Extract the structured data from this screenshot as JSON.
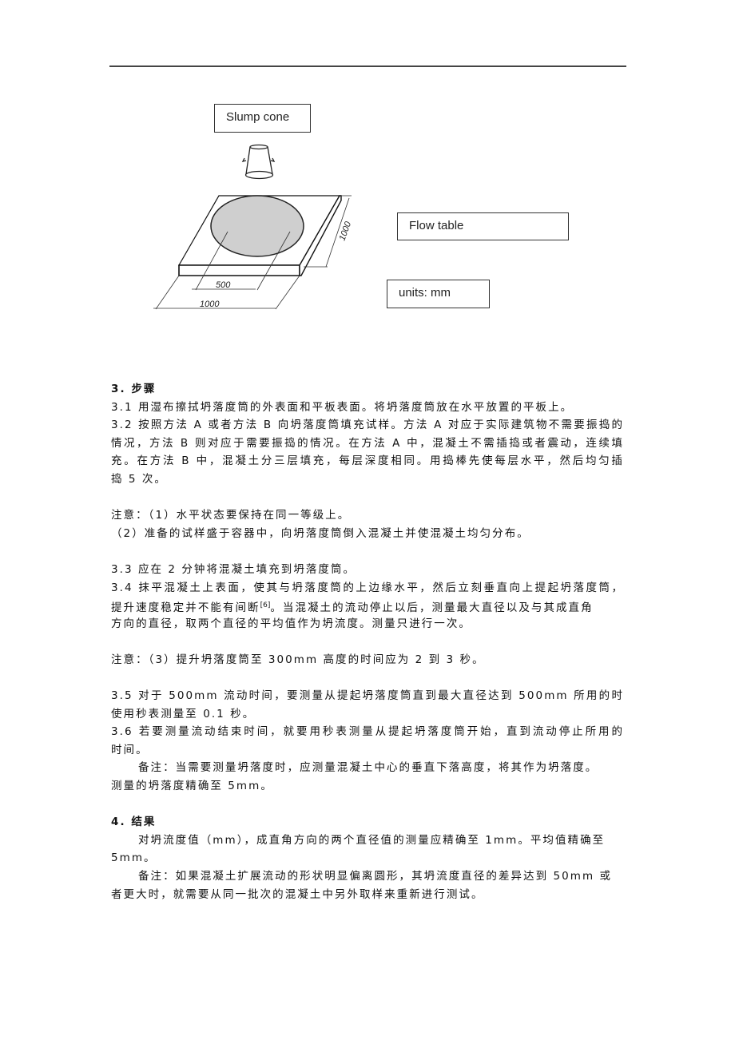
{
  "figure": {
    "slump_cone_label": "Slump cone",
    "flow_table_label": "Flow table",
    "units_label": "units:  mm",
    "dim_diameter": "500",
    "dim_width": "1000",
    "dim_depth": "1000"
  },
  "section3": {
    "heading": "3.   步骤",
    "p3_1": "3.1 用湿布擦拭坍落度筒的外表面和平板表面。将坍落度筒放在水平放置的平板上。",
    "p3_2": [
      "3.2   按照方法 A 或者方法 B 向坍落度筒填充试样。方法 A 对应于实际建筑物不需要振捣的",
      "情况，方法 B 则对应于需要振捣的情况。在方法 A 中，混凝土不需插捣或者震动，连续填",
      "充。在方法 B 中，混凝土分三层填充，每层深度相同。用捣棒先使每层水平，然后均匀插",
      "捣 5 次。"
    ],
    "note1": "注意：（1）水平状态要保持在同一等级上。",
    "note2": "（2）准备的试样盛于容器中，向坍落度筒倒入混凝土并使混凝土均匀分布。",
    "p3_3": "3.3 应在 2 分钟将混凝土填充到坍落度筒。",
    "p3_4": [
      "3.4 抹平混凝土上表面，使其与坍落度筒的上边缘水平，然后立刻垂直向上提起坍落度筒，",
      "提升速度稳定并不能有间断",
      "。当混凝土的流动停止以后，测量最大直径以及与其成直角",
      "方向的直径，取两个直径的平均值作为坍流度。测量只进行一次。"
    ],
    "p3_4_ref": "[6]",
    "note3": "注意：（3）提升坍落度筒至 300mm 高度的时间应为 2 到 3 秒。",
    "p3_5": [
      "3.5 对于 500mm 流动时间，要测量从提起坍落度筒直到最大直径达到 500mm 所用的时间，",
      "使用秒表测量至 0.1 秒。"
    ],
    "p3_6": [
      "3.6   若要测量流动结束时间，就要用秒表测量从提起坍落度筒开始，直到流动停止所用的",
      "时间。"
    ],
    "remark": [
      "备注：当需要测量坍落度时，应测量混凝土中心的垂直下落高度，将其作为坍落度。",
      "测量的坍落度精确至 5mm。"
    ]
  },
  "section4": {
    "heading": "4.   结果",
    "p1": [
      "对坍流度值（mm），成直角方向的两个直径值的测量应精确至 1mm。平均值精确至",
      "5mm。"
    ],
    "remark": [
      "备注：如果混凝土扩展流动的形状明显偏离圆形，其坍流度直径的差异达到 50mm 或",
      "者更大时，就需要从同一批次的混凝土中另外取样来重新进行测试。"
    ]
  }
}
